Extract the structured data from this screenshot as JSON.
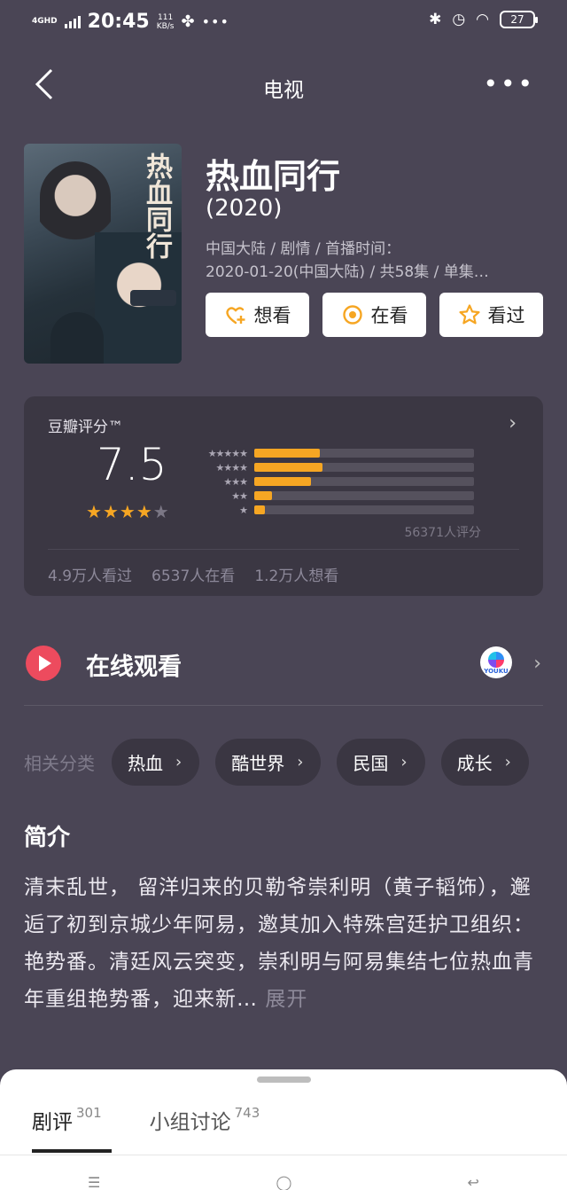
{
  "status": {
    "network": "4GHD",
    "time": "20:45",
    "speed_value": "111",
    "speed_unit": "KB/s",
    "battery": "27"
  },
  "nav": {
    "title": "电视"
  },
  "show": {
    "title": "热血同行",
    "year": "(2020)",
    "meta_line1": "中国大陆 / 剧情 / 首播时间：",
    "meta_line2": "2020-01-20(中国大陆) / 共58集 / 单集…",
    "poster_text": "热血同行"
  },
  "actions": {
    "want": "想看",
    "watching": "在看",
    "watched": "看过"
  },
  "rating": {
    "label": "豆瓣评分™",
    "score": "7.5",
    "stars_filled": 4,
    "stars_total": 5,
    "distribution": [
      {
        "stars": "★★★★★",
        "fraction": 0.3
      },
      {
        "stars": "★★★★",
        "fraction": 0.31
      },
      {
        "stars": "★★★",
        "fraction": 0.26
      },
      {
        "stars": "★★",
        "fraction": 0.08
      },
      {
        "stars": "★",
        "fraction": 0.05
      }
    ],
    "count": "56371人评分",
    "watched": "4.9万人看过",
    "watching": "6537人在看",
    "want": "1.2万人想看"
  },
  "online": {
    "label": "在线观看",
    "provider": "YOUKU"
  },
  "tags": {
    "label": "相关分类",
    "items": [
      "热血",
      "酷世界",
      "民国",
      "成长"
    ]
  },
  "intro": {
    "title": "简介",
    "text": "清末乱世， 留洋归来的贝勒爷崇利明（黄子韬饰），邂逅了初到京城少年阿易，邀其加入特殊宫廷护卫组织：艳势番。清廷风云突变，崇利明与阿易集结七位热血青年重组艳势番，迎来新…",
    "expand": "展开"
  },
  "sheet": {
    "tabs": [
      {
        "label": "剧评",
        "count": "301"
      },
      {
        "label": "小组讨论",
        "count": "743"
      }
    ]
  },
  "colors": {
    "accent": "#f6a623",
    "background": "#4a4555",
    "card": "#3b3743",
    "play": "#ed4b5e"
  }
}
